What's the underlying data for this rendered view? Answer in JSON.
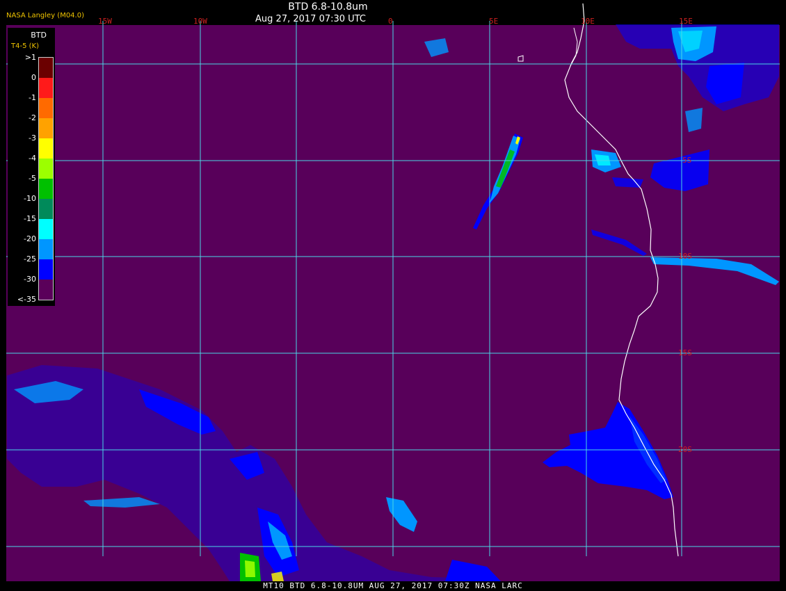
{
  "header": {
    "title": "BTD 6.8-10.8um",
    "timestamp": "Aug 27, 2017 07:30 UTC",
    "agency": "NASA Langley (M04.0)"
  },
  "footer": {
    "caption": "MT10   BTD 6.8-10.8UM   AUG 27, 2017 07:30Z   NASA LARC"
  },
  "legend": {
    "title": "BTD",
    "subtitle": "T4-5 (K)",
    "labels": [
      ">1",
      "0",
      "-1",
      "-2",
      "-3",
      "-4",
      "-5",
      "-10",
      "-15",
      "-20",
      "-25",
      "-30",
      "<-35"
    ],
    "colors": [
      "#6b0000",
      "#ff1a1a",
      "#ff6a00",
      "#ffa200",
      "#ffff00",
      "#9cff00",
      "#00c000",
      "#008a5a",
      "#00ffff",
      "#0096ff",
      "#0000ff",
      "#5a005a"
    ]
  },
  "map": {
    "background_color": "#58005a",
    "grid_color": "#4ad8e6",
    "coast_color": "#ffffff",
    "longitude_labels": [
      "15W",
      "10W",
      "0",
      "5E",
      "10E",
      "15E"
    ],
    "latitude_labels": [
      "5S",
      "10S",
      "15S",
      "20S"
    ]
  }
}
